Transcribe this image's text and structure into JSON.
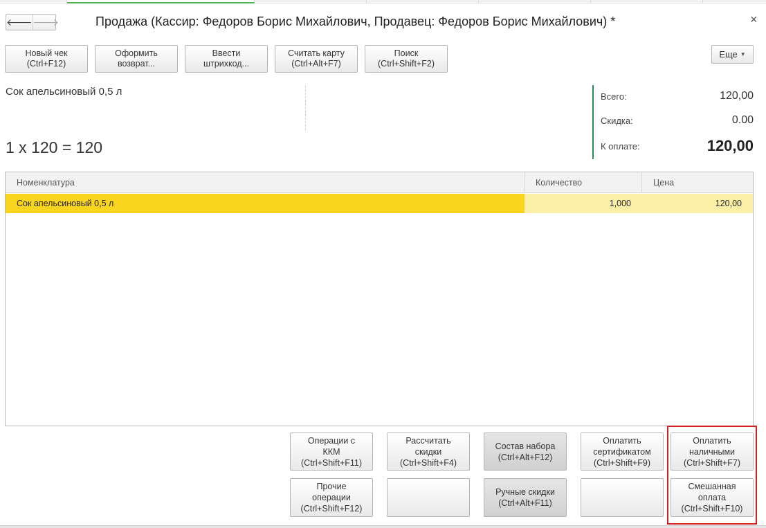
{
  "window": {
    "title": "Продажа (Кассир: Федоров Борис Михайлович, Продавец: Федоров Борис Михайлович) *",
    "back_glyph": "🡐",
    "forward_glyph": "🡒",
    "close_glyph": "×"
  },
  "toolbar": {
    "new_check": [
      "Новый чек",
      "(Ctrl+F12)"
    ],
    "return": [
      "Оформить",
      "возврат..."
    ],
    "barcode": [
      "Ввести",
      "штрихкод..."
    ],
    "card": [
      "Считать карту",
      "(Ctrl+Alt+F7)"
    ],
    "search": [
      "Поиск",
      "(Ctrl+Shift+F2)"
    ],
    "more": "Еще"
  },
  "current_item": {
    "name": "Сок апельсиновый 0,5 л",
    "calculation": "1 x 120 = 120"
  },
  "totals": {
    "total_label": "Всего:",
    "total_value": "120,00",
    "discount_label": "Скидка:",
    "discount_value": "0.00",
    "to_pay_label": "К оплате:",
    "to_pay_value": "120,00",
    "accent_color": "#2e8b57"
  },
  "table": {
    "columns": [
      "Номенклатура",
      "Количество",
      "Цена"
    ],
    "rows": [
      {
        "name": "Сок апельсиновый 0,5 л",
        "quantity": "1,000",
        "price": "120,00"
      }
    ],
    "selected_row_color": "#f9d520"
  },
  "bottom_buttons": {
    "kkm_ops": [
      "Операции с",
      "ККМ",
      "(Ctrl+Shift+F11)"
    ],
    "calc_discounts": [
      "Рассчитать",
      "скидки",
      "(Ctrl+Shift+F4)"
    ],
    "kit": [
      "Состав набора",
      "(Ctrl+Alt+F12)"
    ],
    "pay_certificate": [
      "Оплатить",
      "сертификатом",
      "(Ctrl+Shift+F9)"
    ],
    "pay_cash": [
      "Оплатить",
      "наличными",
      "(Ctrl+Shift+F7)"
    ],
    "other_ops": [
      "Прочие",
      "операции",
      "(Ctrl+Shift+F12)"
    ],
    "manual_discounts": [
      "Ручные скидки",
      "(Ctrl+Alt+F11)"
    ],
    "mixed_payment": [
      "Смешанная",
      "оплата",
      "(Ctrl+Shift+F10)"
    ]
  },
  "highlight_color": "#d32020"
}
